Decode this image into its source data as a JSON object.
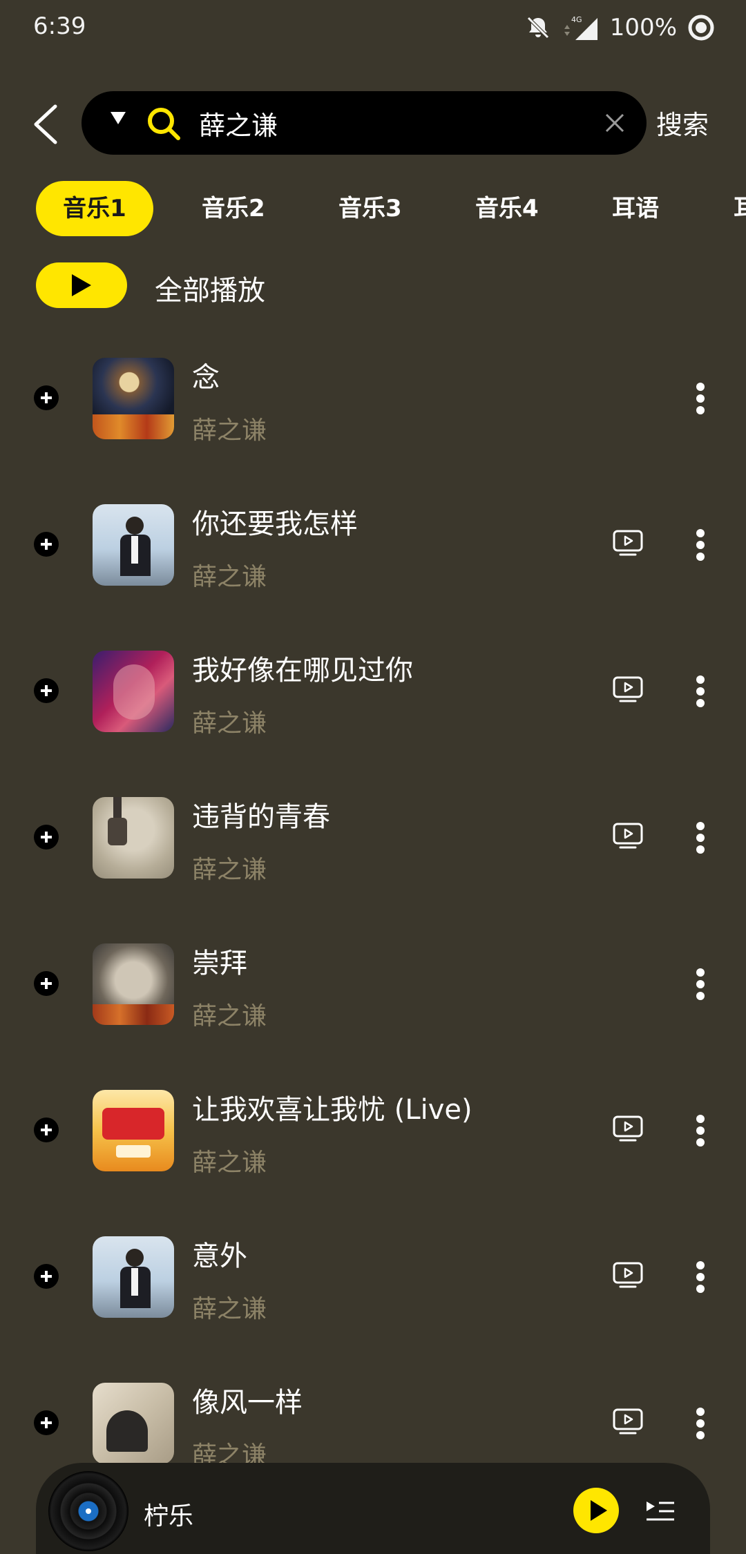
{
  "status_bar": {
    "time": "6:39",
    "network": "4G",
    "battery": "100%"
  },
  "search": {
    "query": "薛之谦",
    "button_label": "搜索"
  },
  "tabs": [
    {
      "label": "音乐1",
      "active": true
    },
    {
      "label": "音乐2",
      "active": false
    },
    {
      "label": "音乐3",
      "active": false
    },
    {
      "label": "音乐4",
      "active": false
    },
    {
      "label": "耳语",
      "active": false
    },
    {
      "label": "耳",
      "active": false
    }
  ],
  "play_all": {
    "label": "全部播放"
  },
  "songs": [
    {
      "title": "念",
      "artist": "薛之谦",
      "has_mv": false
    },
    {
      "title": "你还要我怎样",
      "artist": "薛之谦",
      "has_mv": true
    },
    {
      "title": "我好像在哪见过你",
      "artist": "薛之谦",
      "has_mv": true
    },
    {
      "title": "违背的青春",
      "artist": "薛之谦",
      "has_mv": true
    },
    {
      "title": "崇拜",
      "artist": "薛之谦",
      "has_mv": false
    },
    {
      "title": "让我欢喜让我忧 (Live)",
      "artist": "薛之谦",
      "has_mv": true
    },
    {
      "title": "意外",
      "artist": "薛之谦",
      "has_mv": true
    },
    {
      "title": "像风一样",
      "artist": "薛之谦",
      "has_mv": true
    }
  ],
  "mini_player": {
    "label": "柠乐"
  },
  "colors": {
    "background": "#3b372c",
    "accent": "#ffe600",
    "artist_text": "#8d8367",
    "search_bg": "#000000"
  }
}
